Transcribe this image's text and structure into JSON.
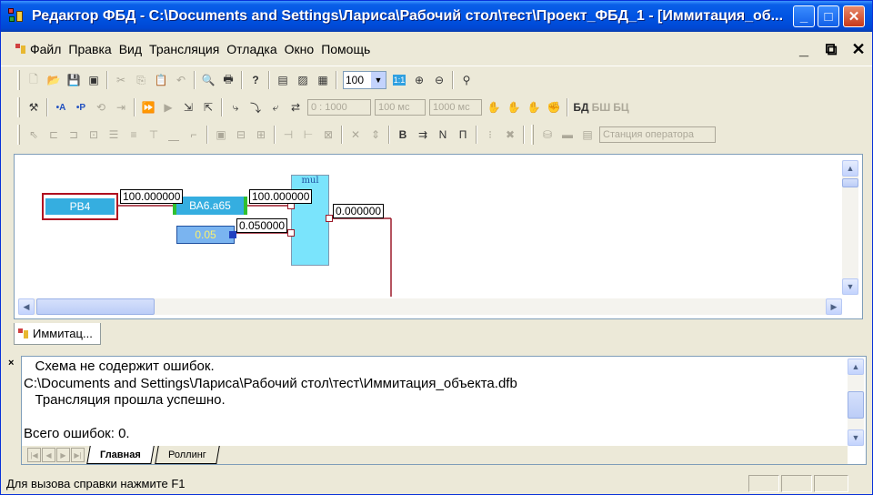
{
  "window": {
    "title": "Редактор ФБД - C:\\Documents and Settings\\Лариса\\Рабочий стол\\тест\\Проект_ФБД_1 - [Иммитация_об...",
    "minimize": "_",
    "maximize": "□",
    "close": "✕"
  },
  "menu": {
    "items": [
      "Файл",
      "Правка",
      "Вид",
      "Трансляция",
      "Отладка",
      "Окно",
      "Помощь"
    ],
    "mdi_minimize": "_",
    "mdi_restore": "⧉",
    "mdi_close": "✕"
  },
  "toolbar1": {
    "zoom_value": "100",
    "fit_label": "1:1"
  },
  "toolbar2": {
    "field_period": "0 : 1000",
    "field_ms1": "100 мс",
    "field_ms2": "1000 мс",
    "btn_bd": "БД",
    "btn_bsh": "БШ",
    "btn_bc": "БЦ"
  },
  "toolbar3": {
    "station_field": "Станция оператора",
    "btn_pi": "П"
  },
  "diagram": {
    "block_rb4": "РВ4",
    "block_ba6": "ВА6.а65",
    "block_const": "0.05",
    "block_mul": "mul",
    "val_rb4_out": "100.000000",
    "val_ba6_out": "100.000000",
    "val_const_out": "0.050000",
    "val_mul_out": "0.000000"
  },
  "doc_tab": {
    "label": "Иммитац..."
  },
  "output": {
    "lines": [
      "   Схема не содержит ошибок.",
      "C:\\Documents and Settings\\Лариса\\Рабочий стол\\тест\\Иммитация_объекта.dfb",
      "   Трансляция прошла успешно.",
      "",
      "Всего ошибок: 0."
    ],
    "tabs": [
      "Главная",
      "Роллинг"
    ]
  },
  "status": {
    "text": "Для вызова справки нажмите F1"
  }
}
